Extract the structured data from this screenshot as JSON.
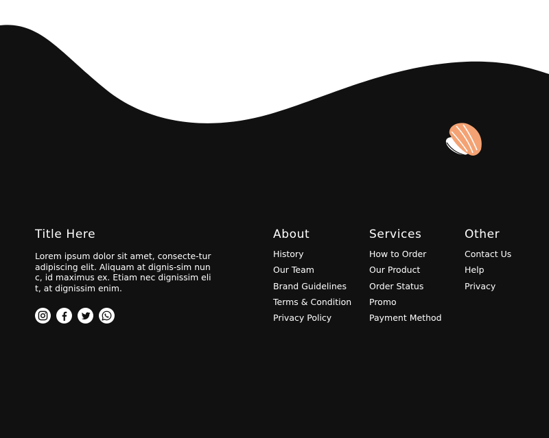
{
  "colors": {
    "background": "#111111",
    "page": "#ffffff",
    "text": "#ffffff",
    "sushi_salmon": "#f4a273",
    "sushi_rice": "#ffffff"
  },
  "brand": {
    "title": "Title Here",
    "description": "Lorem ipsum dolor sit amet, consecte-tur adipiscing elit. Aliquam at dignis-sim nunc, id maximus ex. Etiam nec dignissim elit, at dignissim enim.",
    "logo_icon": "sushi-icon"
  },
  "socials": [
    {
      "icon": "instagram-icon"
    },
    {
      "icon": "facebook-icon"
    },
    {
      "icon": "twitter-icon"
    },
    {
      "icon": "whatsapp-icon"
    }
  ],
  "columns": {
    "about": {
      "title": "About",
      "links": [
        "History",
        "Our Team",
        "Brand Guidelines",
        "Terms & Condition",
        "Privacy Policy"
      ]
    },
    "services": {
      "title": "Services",
      "links": [
        "How to Order",
        "Our Product",
        "Order Status",
        "Promo",
        "Payment Method"
      ]
    },
    "other": {
      "title": "Other",
      "links": [
        "Contact Us",
        "Help",
        "Privacy"
      ]
    }
  }
}
